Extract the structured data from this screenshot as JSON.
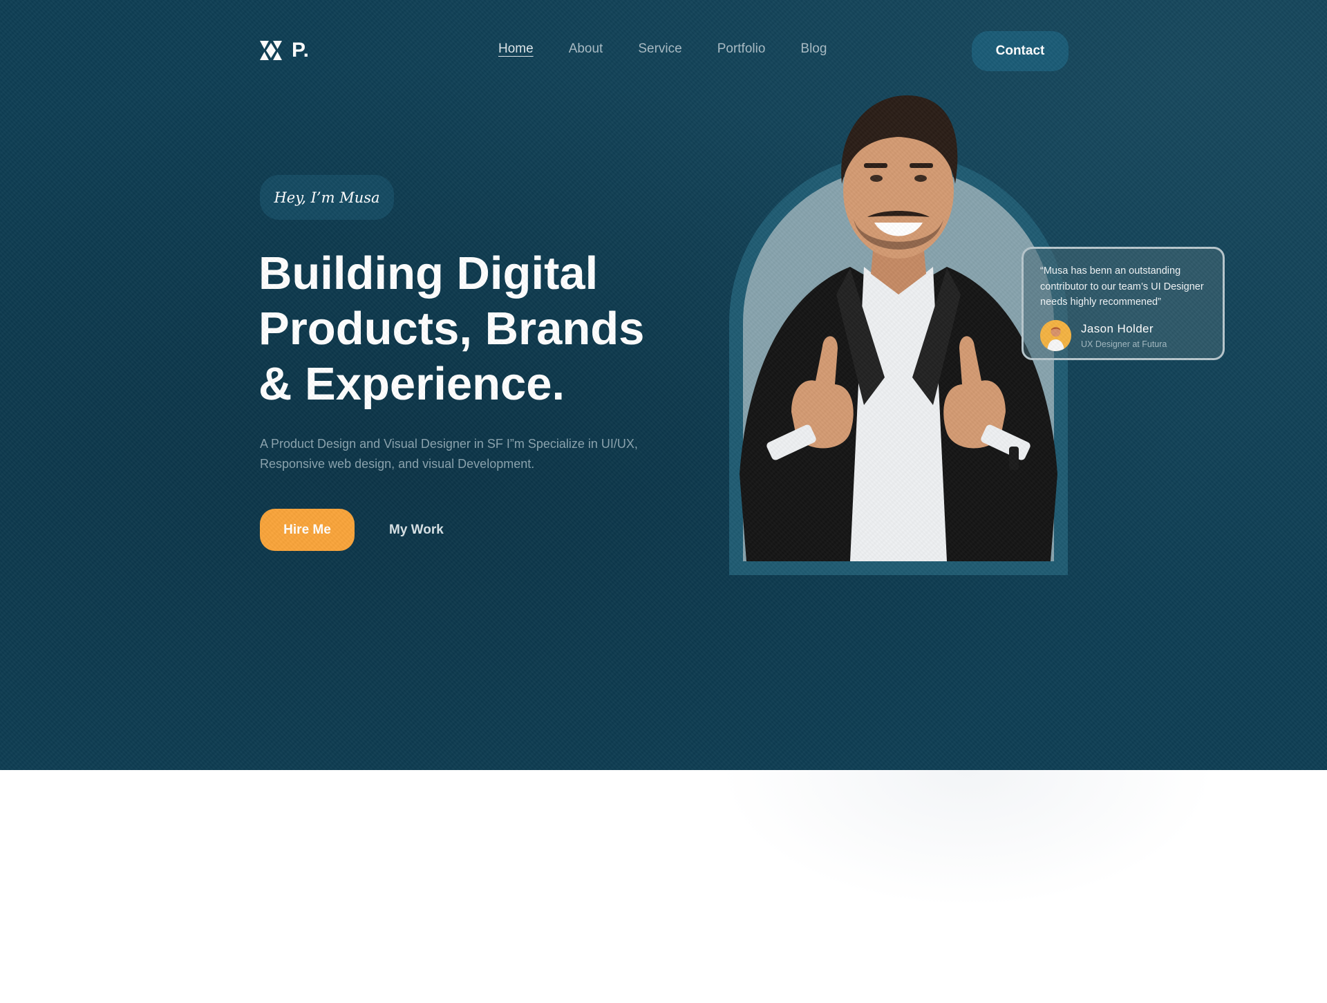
{
  "brand": {
    "logo_text": "P.",
    "logo_icon": "hourglass-x-logo-icon"
  },
  "nav": {
    "items": [
      {
        "label": "Home",
        "active": true
      },
      {
        "label": "About",
        "active": false
      },
      {
        "label": "Service",
        "active": false
      },
      {
        "label": "Portfolio",
        "active": false
      },
      {
        "label": "Blog",
        "active": false
      }
    ],
    "contact_label": "Contact"
  },
  "hero": {
    "greeting": "Hey, I’m Musa",
    "headline": [
      "Building Digital",
      "Products, Brands",
      "& Experience."
    ],
    "subtitle": "A Product Design and Visual Designer in SF I”m Specialize in UI/UX, Responsive web design, and visual Development.",
    "primary_cta": "Hire Me",
    "secondary_cta": "My Work"
  },
  "testimonial": {
    "quote": "“Musa has benn an outstanding contributor to our team’s UI Designer needs highly recommened”",
    "author_name": "Jason Holder",
    "author_role": "UX Designer at Futura"
  },
  "colors": {
    "hero_background": "#0e3e54",
    "accent": "#f9a43a",
    "contact_button": "#1a5b76",
    "arch_outer": "#1f5b72",
    "arch_inner": "#87a3ad"
  }
}
